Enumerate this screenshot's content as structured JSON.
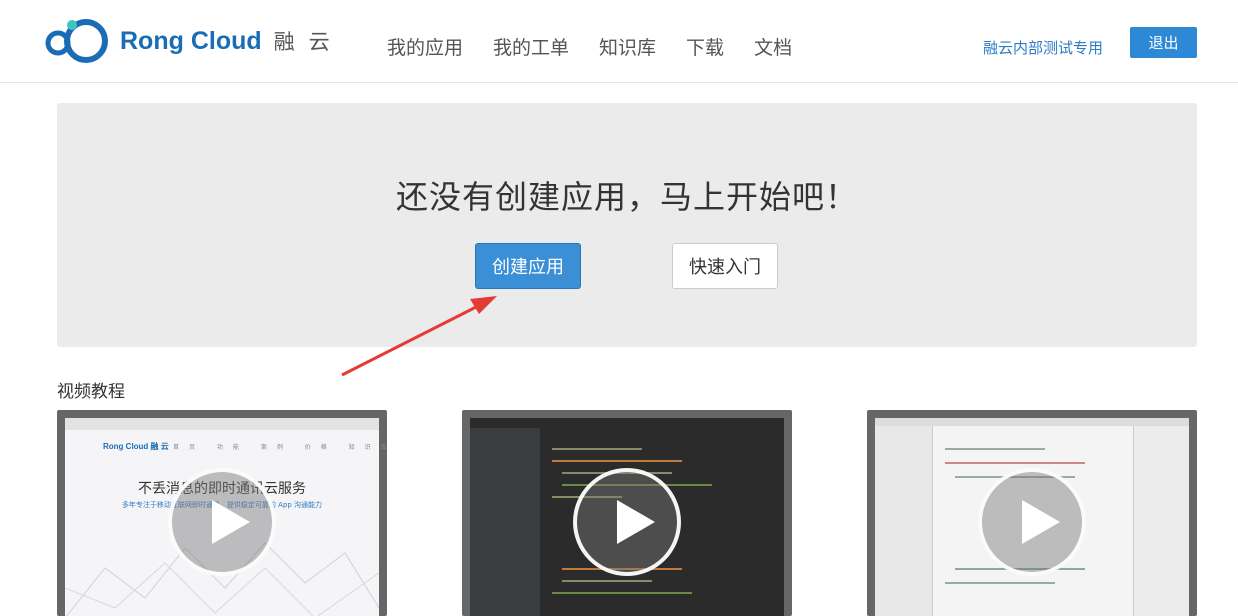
{
  "header": {
    "brand_name": "Rong Cloud",
    "brand_cn": "融云",
    "nav": [
      "我的应用",
      "我的工单",
      "知识库",
      "下载",
      "文档"
    ],
    "internal_link": "融云内部测试专用",
    "logout_label": "退出"
  },
  "hero": {
    "title": "还没有创建应用，马上开始吧！",
    "create_button": "创建应用",
    "quickstart_button": "快速入门"
  },
  "videos": {
    "section_title": "视频教程",
    "v1_brand": "Rong Cloud 融 云",
    "v1_nav": "首页 功能 案例 价格 知识库 文档 下载",
    "v1_headline": "不丢消息的即时通讯云服务",
    "v1_sub": "多年专注于移动互联网即时通讯，提供稳定可靠的 App 沟通能力"
  },
  "colors": {
    "brand_blue": "#1a6db5",
    "button_blue": "#3b8fd6",
    "arrow_red": "#e53a35"
  }
}
